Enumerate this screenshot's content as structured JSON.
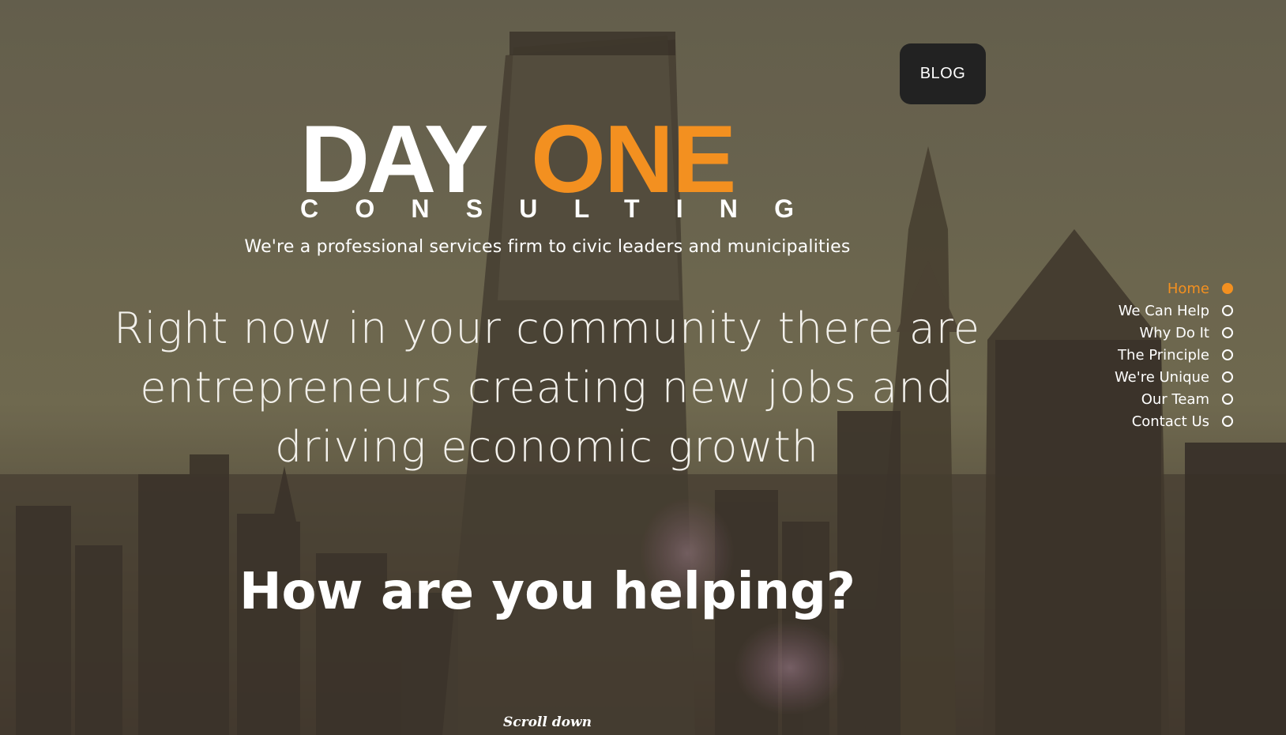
{
  "header": {
    "blog_label": "BLOG"
  },
  "logo": {
    "word_day": "DAY",
    "word_one": "ONE",
    "sub": "CONSULTING",
    "colors": {
      "day": "#ffffff",
      "one": "#f39020",
      "sub": "#ffffff"
    }
  },
  "hero": {
    "tagline": "We're a professional services firm to civic leaders and municipalities",
    "headline_line1": "Right now in your community there are",
    "headline_line2": "entrepreneurs creating new jobs and",
    "headline_line3": "driving economic growth",
    "question": "How are you helping?",
    "scroll_label": "Scroll down"
  },
  "side_nav": {
    "accent_color": "#f39020",
    "items": [
      {
        "label": "Home",
        "active": true
      },
      {
        "label": "We Can Help",
        "active": false
      },
      {
        "label": "Why Do It",
        "active": false
      },
      {
        "label": "The Principle",
        "active": false
      },
      {
        "label": "We're Unique",
        "active": false
      },
      {
        "label": "Our Team",
        "active": false
      },
      {
        "label": "Contact Us",
        "active": false
      }
    ]
  }
}
